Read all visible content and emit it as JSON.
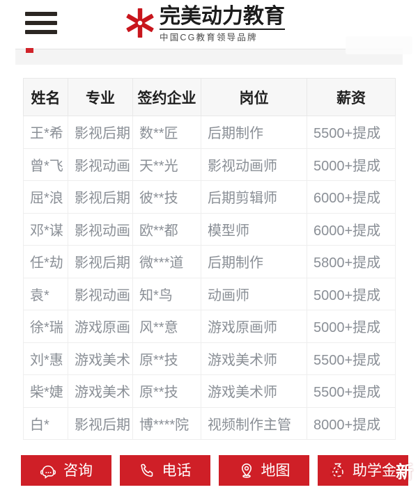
{
  "header": {
    "menu_icon": "hamburger-menu-icon",
    "logo": {
      "mark": "red-asterisk-star-icon",
      "title": "完美动力教育",
      "subtitle": "中国CG教育领导品牌"
    }
  },
  "colors": {
    "brand_red": "#cf1f27",
    "logo_red": "#c8161d",
    "header_bg": "#f7f7f7",
    "cell_text": "#8a8f96",
    "header_text": "#1f1f1f",
    "border": "#eeeeee"
  },
  "table": {
    "columns": [
      "姓名",
      "专业",
      "签约企业",
      "岗位",
      "薪资"
    ],
    "rows": [
      {
        "name": "王*希",
        "major": "影视后期",
        "company": "数**匠",
        "position": "后期制作",
        "salary": "5500+提成"
      },
      {
        "name": "曾*飞",
        "major": "影视动画",
        "company": "天**光",
        "position": "影视动画师",
        "salary": "5000+提成"
      },
      {
        "name": "屈*浪",
        "major": "影视后期",
        "company": "彼**技",
        "position": "后期剪辑师",
        "salary": "6000+提成"
      },
      {
        "name": "邓*谋",
        "major": "影视动画",
        "company": "欧**都",
        "position": "模型师",
        "salary": "6000+提成"
      },
      {
        "name": "任*劫",
        "major": "影视后期",
        "company": "微***道",
        "position": "后期制作",
        "salary": "5800+提成"
      },
      {
        "name": "袁*",
        "major": "影视动画",
        "company": "知*鸟",
        "position": "动画师",
        "salary": "5000+提成"
      },
      {
        "name": "徐*瑞",
        "major": "游戏原画",
        "company": "风**意",
        "position": "游戏原画师",
        "salary": "5000+提成"
      },
      {
        "name": "刘*惠",
        "major": "游戏美术",
        "company": "原**技",
        "position": "游戏美术师",
        "salary": "5500+提成"
      },
      {
        "name": "柴*婕",
        "major": "游戏美术",
        "company": "原**技",
        "position": "游戏美术师",
        "salary": "5500+提成"
      },
      {
        "name": "白*",
        "major": "影视后期",
        "company": "博****院",
        "position": "视频制作主管",
        "salary": "8000+提成"
      }
    ]
  },
  "bottom_bar": {
    "buttons": [
      {
        "label": "咨询",
        "icon": "headset-chat-icon"
      },
      {
        "label": "电话",
        "icon": "phone-icon"
      },
      {
        "label": "地图",
        "icon": "location-pin-icon"
      },
      {
        "label": "助学金",
        "icon": "money-bag-icon"
      }
    ],
    "watermark_char": "新"
  }
}
